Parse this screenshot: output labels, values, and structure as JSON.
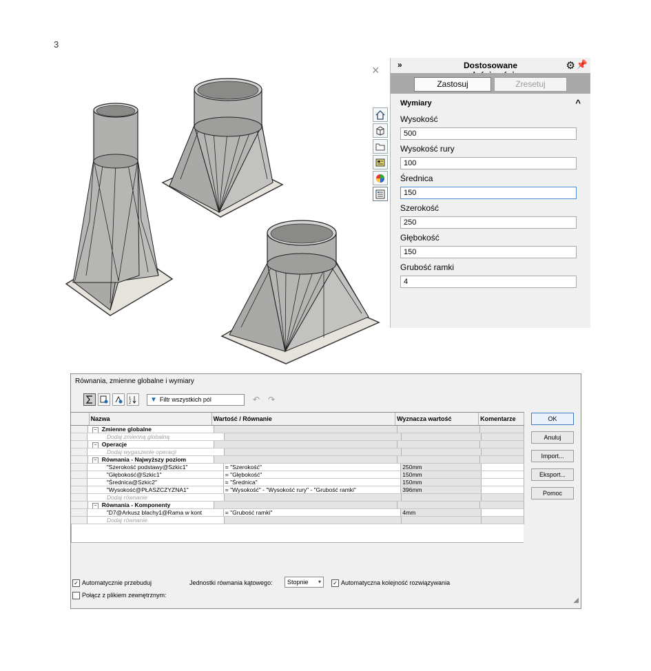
{
  "page": {
    "number": "3"
  },
  "property_manager": {
    "close_glyph": "×",
    "expand_glyph": "»",
    "title": "Dostosowane właściwości",
    "apply_label": "Zastosuj",
    "reset_label": "Zresetuj",
    "section_title": "Wymiary",
    "properties": [
      {
        "label": "Wysokość",
        "value": "500"
      },
      {
        "label": "Wysokość rury",
        "value": "100"
      },
      {
        "label": "Średnica",
        "value": "150"
      },
      {
        "label": "Szerokość",
        "value": "250"
      },
      {
        "label": "Głębokość",
        "value": "150"
      },
      {
        "label": "Grubość ramki",
        "value": "4"
      }
    ],
    "side_tabs": [
      "home-icon",
      "part-icon",
      "folder-icon",
      "property-icon",
      "appearance-icon",
      "custom-properties-icon"
    ]
  },
  "equations_dialog": {
    "title": "Równania, zmienne globalne i wymiary",
    "filter_placeholder": "Filtr wszystkich pól",
    "columns": {
      "name": "Nazwa",
      "value": "Wartość / Równanie",
      "evaluates": "Wyznacza wartość",
      "comments": "Komentarze"
    },
    "groups": [
      {
        "name": "Zmienne globalne",
        "rows": [],
        "add_text": "Dodaj zmienną globalną"
      },
      {
        "name": "Operacje",
        "rows": [],
        "add_text": "Dodaj wygaszenie operacji"
      },
      {
        "name": "Równania - Najwyższy poziom",
        "rows": [
          {
            "name": "\"Szerokość podstawy@Szkic1\"",
            "value": "= \"Szerokość\"",
            "evaluates": "250mm",
            "comment": ""
          },
          {
            "name": "\"Głębokość@Szkic1\"",
            "value": "= \"Głębokość\"",
            "evaluates": "150mm",
            "comment": ""
          },
          {
            "name": "\"Średnica@Szkic2\"",
            "value": "= \"Średnica\"",
            "evaluates": "150mm",
            "comment": ""
          },
          {
            "name": "\"Wysokość@PŁASZCZYZNA1\"",
            "value": "= \"Wysokość\" - \"Wysokość rury\" - \"Grubość ramki\"",
            "evaluates": "396mm",
            "comment": ""
          }
        ],
        "add_text": "Dodaj równanie"
      },
      {
        "name": "Równania - Komponenty",
        "rows": [
          {
            "name": "\"D7@Arkusz blachy1@Rama w kont",
            "value": "= \"Grubość ramki\"",
            "evaluates": "4mm",
            "comment": ""
          }
        ],
        "add_text": "Dodaj równanie"
      }
    ],
    "buttons": {
      "ok": "OK",
      "cancel": "Anuluj",
      "import": "Import...",
      "export": "Eksport...",
      "help": "Pomoc"
    },
    "auto_rebuild_label": "Automatycznie przebuduj",
    "auto_rebuild_checked": true,
    "angle_unit_label": "Jednostki równania kątowego:",
    "angle_unit_value": "Stopnie",
    "auto_order_label": "Automatyczna kolejność rozwiązywania",
    "auto_order_checked": true,
    "link_file_label": "Połącz z plikiem zewnętrznym:",
    "link_file_checked": false
  },
  "colors": {
    "panel_bg": "#f0f0f0",
    "button_bar": "#a9a9a9",
    "model_face": "#b4b4b2",
    "plate": "#e6e3dd",
    "focus_border": "#4b8fd5"
  }
}
